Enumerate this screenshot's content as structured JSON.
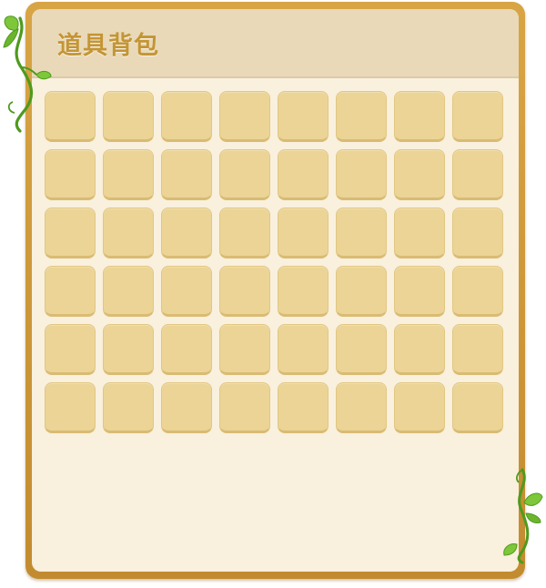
{
  "window": {
    "title": "道具背包"
  },
  "inventory": {
    "rows": 6,
    "columns": 8,
    "slots": [
      {
        "item": null
      },
      {
        "item": null
      },
      {
        "item": null
      },
      {
        "item": null
      },
      {
        "item": null
      },
      {
        "item": null
      },
      {
        "item": null
      },
      {
        "item": null
      },
      {
        "item": null
      },
      {
        "item": null
      },
      {
        "item": null
      },
      {
        "item": null
      },
      {
        "item": null
      },
      {
        "item": null
      },
      {
        "item": null
      },
      {
        "item": null
      },
      {
        "item": null
      },
      {
        "item": null
      },
      {
        "item": null
      },
      {
        "item": null
      },
      {
        "item": null
      },
      {
        "item": null
      },
      {
        "item": null
      },
      {
        "item": null
      },
      {
        "item": null
      },
      {
        "item": null
      },
      {
        "item": null
      },
      {
        "item": null
      },
      {
        "item": null
      },
      {
        "item": null
      },
      {
        "item": null
      },
      {
        "item": null
      },
      {
        "item": null
      },
      {
        "item": null
      },
      {
        "item": null
      },
      {
        "item": null
      },
      {
        "item": null
      },
      {
        "item": null
      },
      {
        "item": null
      },
      {
        "item": null
      },
      {
        "item": null
      },
      {
        "item": null
      },
      {
        "item": null
      },
      {
        "item": null
      },
      {
        "item": null
      },
      {
        "item": null
      },
      {
        "item": null
      },
      {
        "item": null
      }
    ]
  },
  "colors": {
    "frame": "#c99535",
    "header_bg": "#e9d9b8",
    "panel_bg": "#f9f0dd",
    "slot_bg": "#ebd496",
    "title_text": "#c49534",
    "vine": "#4f9a1e",
    "leaf": "#7ec63a"
  },
  "decorations": {
    "icons": [
      "vine-top-left-icon",
      "vine-bottom-right-icon"
    ]
  }
}
